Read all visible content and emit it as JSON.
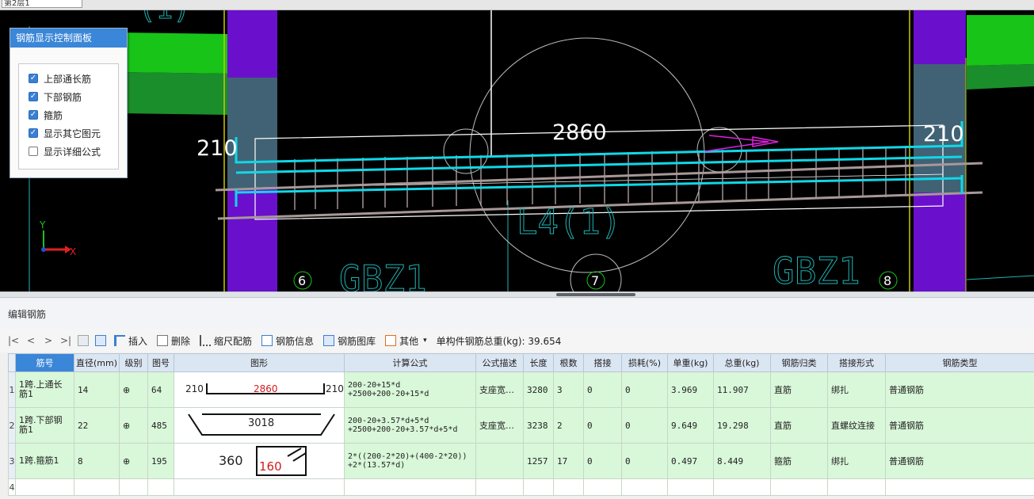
{
  "topbar": {
    "floor_value": "第2层1"
  },
  "viewport": {
    "label_left_210": "210",
    "label_right_210": "210",
    "label_span": "2860",
    "label_beam": "L4(1)",
    "label_top_beam": "(1)",
    "label_gbz_left": "GBZ1",
    "label_gbz_right": "GBZ1",
    "axis_6": "6",
    "axis_7": "7",
    "axis_8": "8",
    "axis_x": "X",
    "axis_y": "Y",
    "colors": {
      "green": "#18c418",
      "purple": "#6a10cc",
      "cyan": "#10d8e8",
      "magenta": "#e020e0"
    }
  },
  "panel": {
    "title": "钢筋显示控制面板",
    "options": [
      {
        "label": "上部通长筋",
        "checked": true
      },
      {
        "label": "下部钢筋",
        "checked": true
      },
      {
        "label": "箍筋",
        "checked": true
      },
      {
        "label": "显示其它图元",
        "checked": true
      },
      {
        "label": "显示详细公式",
        "checked": false
      }
    ]
  },
  "editor": {
    "title": "编辑钢筋",
    "toolbar": {
      "first": "|<",
      "prev": "<",
      "next": ">",
      "last": ">|",
      "insert": "插入",
      "delete": "删除",
      "scale_rebar": "缩尺配筋",
      "rebar_info": "钢筋信息",
      "rebar_library": "钢筋图库",
      "other": "其他",
      "total_label": "单构件钢筋总重(kg): 39.654"
    },
    "columns": [
      "筋号",
      "直径(mm)",
      "级别",
      "图号",
      "图形",
      "计算公式",
      "公式描述",
      "长度",
      "根数",
      "搭接",
      "损耗(%)",
      "单重(kg)",
      "总重(kg)",
      "钢筋归类",
      "搭接形式",
      "钢筋类型"
    ],
    "rows": [
      {
        "rn": "1",
        "name": "1跨.上通长筋1",
        "dia": "14",
        "grade": "⊕",
        "fig": "64",
        "shape": {
          "left": "210",
          "mid": "2860",
          "right": "210"
        },
        "formula1": "200-20+15*d",
        "formula2": "+2500+200-20+15*d",
        "desc": "支座宽…",
        "len": "3280",
        "count": "3",
        "lap": "0",
        "loss": "0",
        "unit": "3.969",
        "total": "11.907",
        "cat": "直筋",
        "lapform": "绑扎",
        "type": "普通钢筋"
      },
      {
        "rn": "2",
        "name": "1跨.下部钢筋1",
        "dia": "22",
        "grade": "⊕",
        "fig": "485",
        "shape": {
          "mid": "3018"
        },
        "formula1": "200-20+3.57*d+5*d",
        "formula2": "+2500+200-20+3.57*d+5*d",
        "desc": "支座宽…",
        "len": "3238",
        "count": "2",
        "lap": "0",
        "loss": "0",
        "unit": "9.649",
        "total": "19.298",
        "cat": "直筋",
        "lapform": "直螺纹连接",
        "type": "普通钢筋"
      },
      {
        "rn": "3",
        "name": "1跨.箍筋1",
        "dia": "8",
        "grade": "⊕",
        "fig": "195",
        "shape": {
          "left": "360",
          "mid": "160"
        },
        "formula1": "2*((200-2*20)+(400-2*20))",
        "formula2": "+2*(13.57*d)",
        "desc": "",
        "len": "1257",
        "count": "17",
        "lap": "0",
        "loss": "0",
        "unit": "0.497",
        "total": "8.449",
        "cat": "箍筋",
        "lapform": "绑扎",
        "type": "普通钢筋"
      }
    ],
    "empty_row_rn": "4"
  }
}
